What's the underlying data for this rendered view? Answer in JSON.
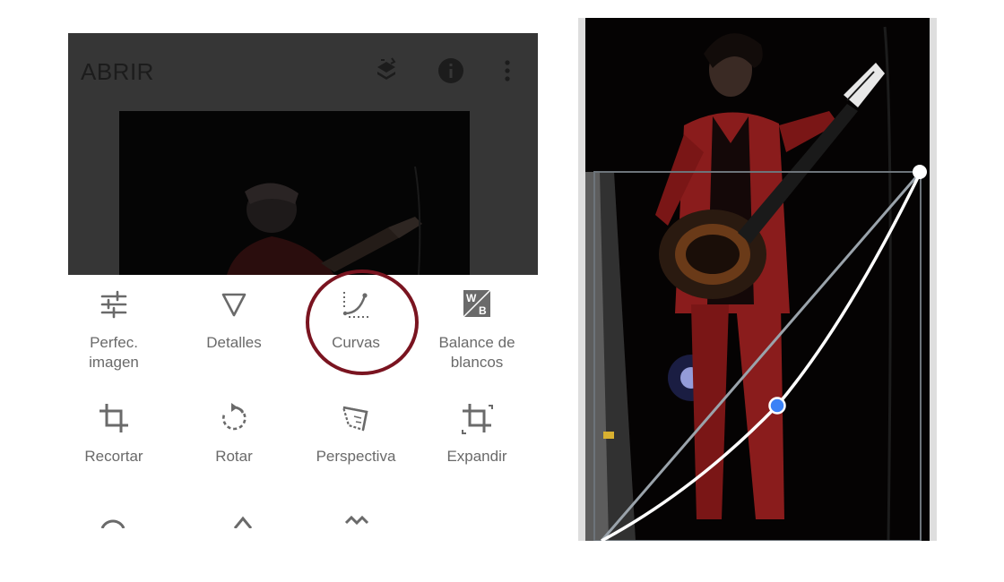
{
  "app": {
    "title": "ABRIR"
  },
  "header_icons": [
    "layers-swap-icon",
    "info-icon",
    "more-vert-icon"
  ],
  "tools": [
    {
      "label": "Perfec.\nimagen",
      "icon": "tune-sliders-icon"
    },
    {
      "label": "Detalles",
      "icon": "triangle-details-icon"
    },
    {
      "label": "Curvas",
      "icon": "curves-icon",
      "highlighted": true
    },
    {
      "label": "Balance de\nblancos",
      "icon": "white-balance-icon"
    },
    {
      "label": "Recortar",
      "icon": "crop-icon"
    },
    {
      "label": "Rotar",
      "icon": "rotate-icon"
    },
    {
      "label": "Perspectiva",
      "icon": "perspective-icon"
    },
    {
      "label": "Expandir",
      "icon": "expand-icon"
    }
  ],
  "colors": {
    "highlight_ring": "#7a1420",
    "curve_control_point": "#3b82f6",
    "curve_line": "#ffffff",
    "diagonal_reference": "#9aa3ab",
    "toolbar_dim": "#363636",
    "label_gray": "#6a6a6a"
  }
}
